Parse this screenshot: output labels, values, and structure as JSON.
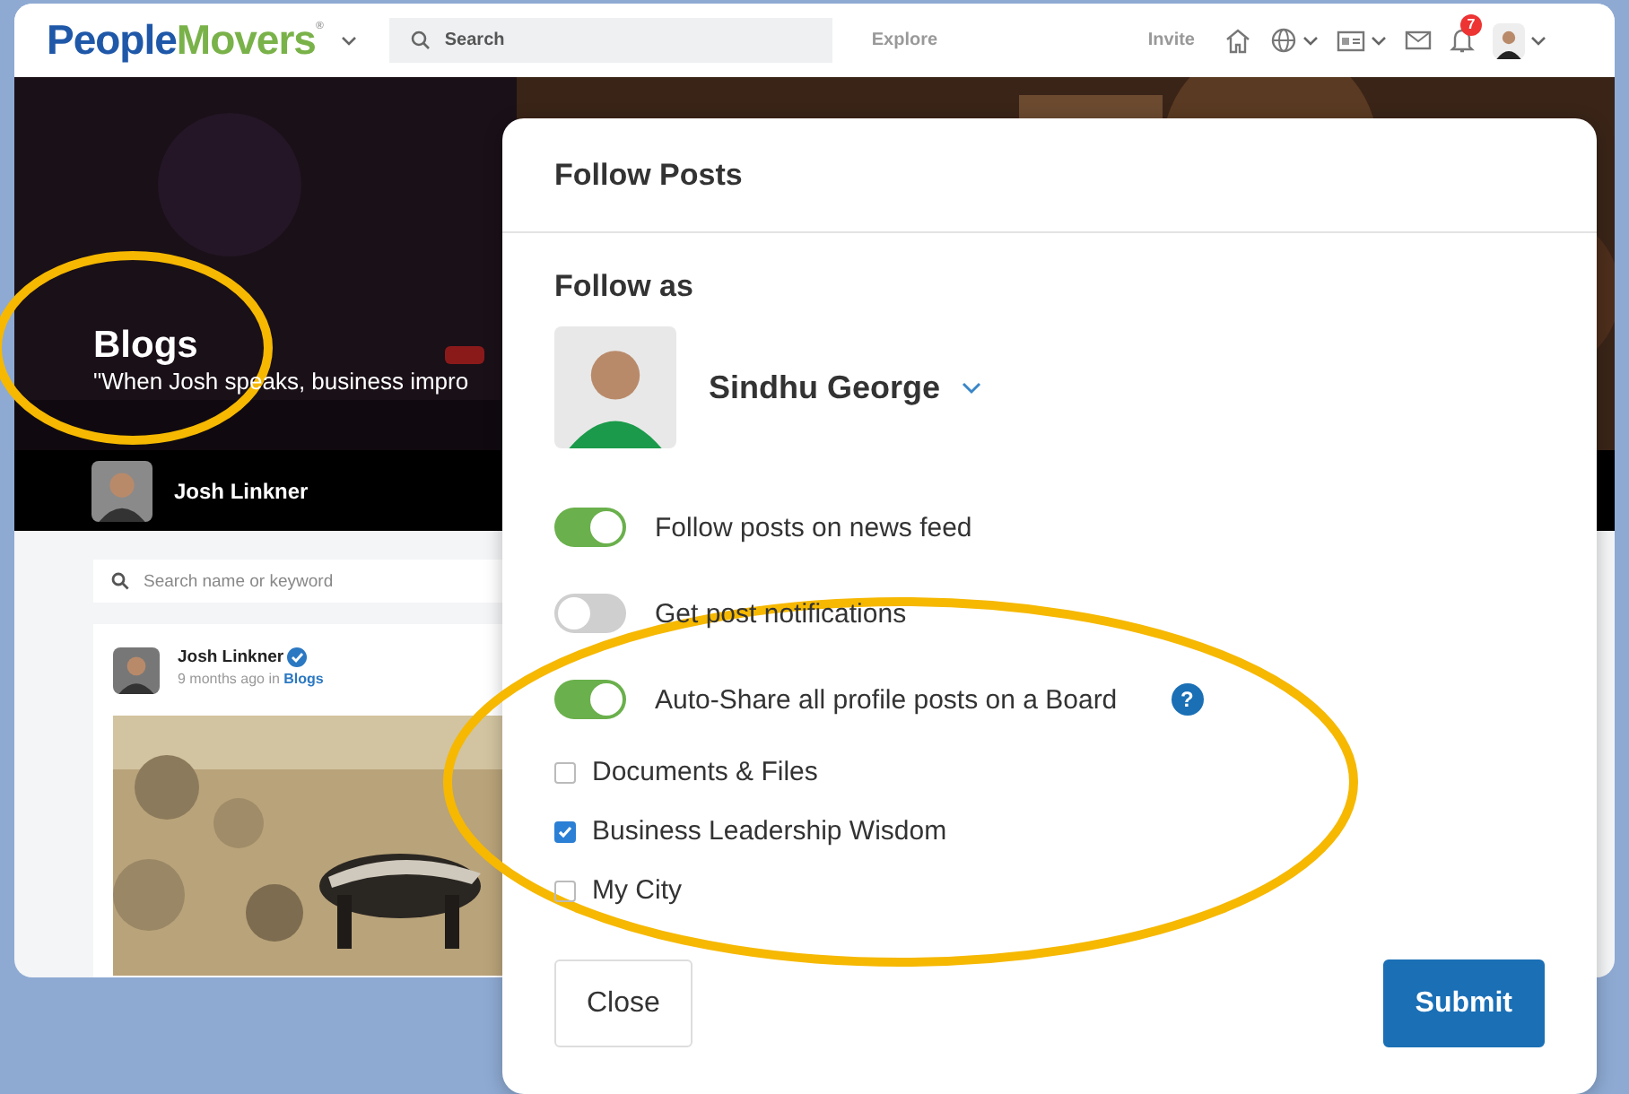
{
  "nav": {
    "logo": {
      "first": "People",
      "second": "Movers",
      "mark": "®"
    },
    "search_placeholder": "Search",
    "links": [
      "Explore",
      "Invite"
    ],
    "notification_count": "7"
  },
  "banner": {
    "title": "Blogs",
    "quote": "\"When Josh speaks, business impro",
    "author": "Josh Linkner"
  },
  "feed": {
    "search_placeholder": "Search name or keyword",
    "post": {
      "author": "Josh Linkner",
      "verified": true,
      "time": "9 months ago in",
      "board": "Blogs"
    }
  },
  "modal": {
    "title": "Follow Posts",
    "follow_as_label": "Follow as",
    "account": "Sindhu George",
    "toggles": [
      {
        "label": "Follow posts on news feed",
        "on": true
      },
      {
        "label": "Get post notifications",
        "on": false
      },
      {
        "label": "Auto-Share all profile posts on a Board",
        "on": true,
        "help": "?"
      }
    ],
    "boards": [
      {
        "label": "Documents & Files",
        "checked": false
      },
      {
        "label": "Business Leadership Wisdom",
        "checked": true
      },
      {
        "label": "My City",
        "checked": false
      }
    ],
    "buttons": [
      {
        "label": "Close",
        "kind": "secondary"
      },
      {
        "label": "Submit",
        "kind": "primary"
      }
    ]
  },
  "annotations": [
    {
      "kind": "ellipse"
    },
    {
      "kind": "ellipse"
    }
  ]
}
